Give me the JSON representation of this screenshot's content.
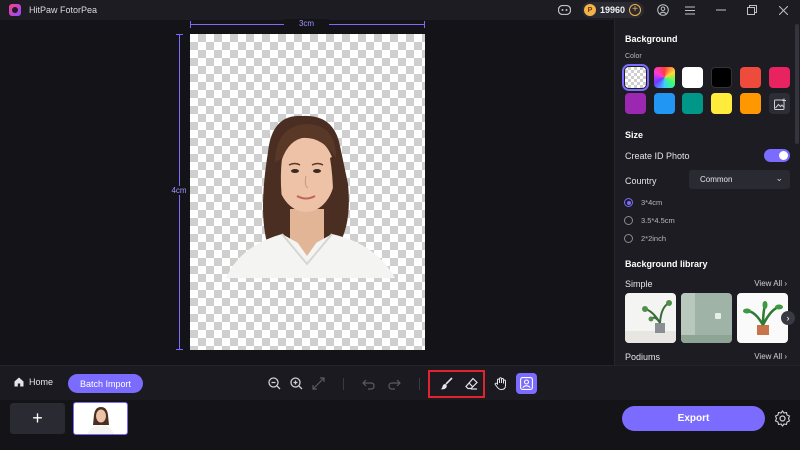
{
  "titlebar": {
    "app_title": "HitPaw FotorPea",
    "credits": "19960",
    "icons": [
      "discord-icon",
      "coin-icon",
      "add-credits-icon",
      "account-icon",
      "menu-icon",
      "minimize-icon",
      "restore-icon",
      "close-icon"
    ]
  },
  "canvas": {
    "width_label": "3cm",
    "height_label": "4cm"
  },
  "panel": {
    "background_title": "Background",
    "color_label": "Color",
    "colors": [
      "transparent",
      "rainbow",
      "#ffffff",
      "#000000",
      "#ee4b3c",
      "#e8235f",
      "#9c27b0",
      "#2196f3",
      "#009688",
      "#ffeb3b",
      "#ff9800",
      "upload"
    ],
    "size_title": "Size",
    "create_id_label": "Create ID Photo",
    "create_id_on": true,
    "country_label": "Country",
    "country_value": "Common",
    "size_options": [
      {
        "label": "3*4cm",
        "checked": true
      },
      {
        "label": "3.5*4.5cm",
        "checked": false
      },
      {
        "label": "2*2inch",
        "checked": false
      }
    ],
    "library_title": "Background library",
    "simple_label": "Simple",
    "view_all": "View All",
    "podiums_label": "Podiums"
  },
  "toolbar": {
    "home_label": "Home",
    "batch_label": "Batch Import",
    "tools": [
      "zoom-out-icon",
      "zoom-in-icon",
      "fit-screen-icon",
      "undo-icon",
      "redo-icon",
      "brush-icon",
      "eraser-icon",
      "hand-icon",
      "portrait-icon"
    ]
  },
  "filmstrip": {
    "add_label": "+",
    "export_label": "Export"
  },
  "colors": {
    "accent": "#7b6cff",
    "highlight": "#e0262c",
    "panel": "#1c1c22",
    "background": "#141418"
  }
}
